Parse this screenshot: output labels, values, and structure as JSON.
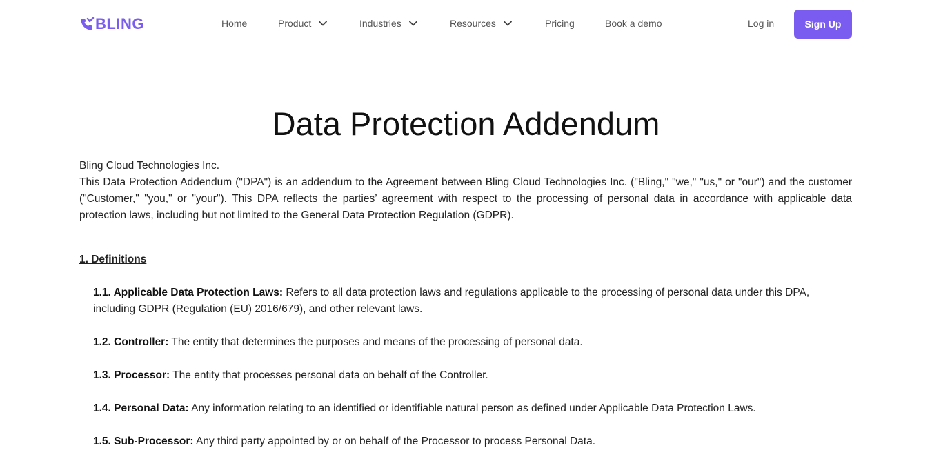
{
  "nav": {
    "logo_text": "BLING",
    "items": [
      {
        "label": "Home",
        "dropdown": false
      },
      {
        "label": "Product",
        "dropdown": true
      },
      {
        "label": "Industries",
        "dropdown": true
      },
      {
        "label": "Resources",
        "dropdown": true
      },
      {
        "label": "Pricing",
        "dropdown": false
      },
      {
        "label": "Book a demo",
        "dropdown": false
      }
    ],
    "login": "Log in",
    "signup": "Sign Up",
    "accent_color": "#7b5cf0"
  },
  "doc": {
    "title": "Data Protection Addendum",
    "company": "Bling Cloud Technologies Inc.",
    "intro": "This Data Protection Addendum (\"DPA\") is an addendum to the Agreement between Bling Cloud Technologies Inc. (\"Bling,\" \"we,\" \"us,\" or \"our\") and the customer (\"Customer,\" \"you,\" or \"your\"). This DPA reflects the parties’ agreement with respect to the processing of personal data in accordance with applicable data protection laws, including but not limited to the General Data Protection Regulation (GDPR).",
    "section1": "1. Definitions",
    "definitions": [
      {
        "term": "1.1. Applicable Data Protection Laws:",
        "text": " Refers to all data protection laws and regulations applicable to the processing of personal data under this DPA, including GDPR (Regulation (EU) 2016/679), and other relevant laws."
      },
      {
        "term": "1.2. Controller:",
        "text": " The entity that determines the purposes and means of the processing of personal data."
      },
      {
        "term": "1.3. Processor:",
        "text": " The entity that processes personal data on behalf of the Controller."
      },
      {
        "term": "1.4. Personal Data:",
        "text": " Any information relating to an identified or identifiable natural person as defined under Applicable Data Protection Laws."
      },
      {
        "term": "1.5. Sub-Processor:",
        "text": " Any third party appointed by or on behalf of the Processor to process Personal Data."
      }
    ]
  }
}
